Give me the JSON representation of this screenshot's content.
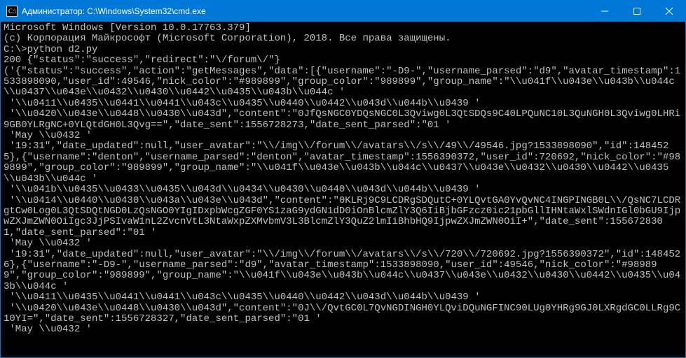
{
  "titlebar": {
    "icon_name": "cmd-icon",
    "title": "Администратор: C:\\Windows\\System32\\cmd.exe",
    "min_label": "minimize",
    "max_label": "maximize",
    "close_label": "close"
  },
  "terminal": {
    "lines": [
      "Microsoft Windows [Version 10.0.17763.379]",
      "(c) Корпорация Майкрософт (Microsoft Corporation), 2018. Все права защищены.",
      "",
      "C:\\>python d2.py",
      "200 {\"status\":\"success\",\"redirect\":\"\\/forum\\/\"}",
      "('{\"status\":\"success\",\"action\":\"getMessages\",\"data\":[{\"username\":\"-D9-\",\"username_parsed\":\"d9\",\"avatar_timestamp\":1533898090,\"user_id\":49546,\"nick_color\":\"#989899\",\"group_color\":\"989899\",\"group_name\":\"\\\\u041f\\\\u043e\\\\u043b\\\\u044c\\\\u0437\\\\u043e\\\\u0432\\\\u0430\\\\u0442\\\\u0435\\\\u043b\\\\u044c '",
      " '\\\\u0411\\\\u0435\\\\u0441\\\\u0441\\\\u043c\\\\u0435\\\\u0440\\\\u0442\\\\u043d\\\\u044b\\\\u0439 '",
      " '\\\\u0420\\\\u043e\\\\u0448\\\\u0430\\\\u043d\",\"content\":\"0JfQsNGC0YDQsNGC0L3Qviwg0L3QtSDQs9C40LPQuNC10L3QuNGH0L3Qviwg0LHRi9GB0YLRgNC+0YLQtdGH0L3Qvg==\",\"date_sent\":1556728273,\"date_sent_parsed\":\"01 '",
      " 'May \\\\u0432 '",
      " '19:31\",\"date_updated\":null,\"user_avatar\":\"\\\\/img\\\\/forum\\\\/avatars\\\\/s\\\\/49\\\\/49546.jpg?1533898090\",\"id\":1484525},{\"username\":\"denton\",\"username_parsed\":\"denton\",\"avatar_timestamp\":1556390372,\"user_id\":720692,\"nick_color\":\"#989899\",\"group_color\":\"989899\",\"group_name\":\"\\\\u041f\\\\u043e\\\\u043b\\\\u044c\\\\u0437\\\\u043e\\\\u0432\\\\u0430\\\\u0442\\\\u0435\\\\u043b\\\\u044c '",
      " '\\\\u041b\\\\u0435\\\\u0433\\\\u0435\\\\u043d\\\\u0434\\\\u0430\\\\u0440\\\\u043d\\\\u044b\\\\u0439 '",
      " '\\\\u0414\\\\u0440\\\\u0430\\\\u043a\\\\u043e\\\\u043d\",\"content\":\"0KLRj9C9LCDRgSDQutC+0YLQvtGA0YvQvNC4INGPINGB0L\\\\/QsNC7LCDRgtCw0Log0L3QtSDQtNGD0LzQsNGO0YIgIDxpbWcgZGF0YS1zaG9ydGN1dD0iOnBlcmZlY3Q6IiBjbGFzcz0ic21pbGllIHNtaWxlSWdnIGl0bGU9IjpwZXJmZWN0OiIgc3JjPSIvaW1nL2ZvcnVtL3NtaWxpZXMvbmV3L3BlcmZlY3QuZ2lmIiBhbHQ9IjpwZXJmZWN0OiI+\",\"date_sent\":1556728301,\"date_sent_parsed\":\"01 '",
      " 'May \\\\u0432 '",
      " '19:31\",\"date_updated\":null,\"user_avatar\":\"\\\\/img\\\\/forum\\\\/avatars\\\\/s\\\\/720\\\\/720692.jpg?1556390372\",\"id\":1484526},{\"username\":\"-D9-\",\"username_parsed\":\"d9\",\"avatar_timestamp\":1533898090,\"user_id\":49546,\"nick_color\":\"#989899\",\"group_color\":\"989899\",\"group_name\":\"\\\\u041f\\\\u043e\\\\u043b\\\\u044c\\\\u0437\\\\u043e\\\\u0432\\\\u0430\\\\u0442\\\\u0435\\\\u043b\\\\u044c '",
      " '\\\\u0411\\\\u0435\\\\u0441\\\\u0441\\\\u043c\\\\u0435\\\\u0440\\\\u0442\\\\u043d\\\\u044b\\\\u0439 '",
      " '\\\\u0420\\\\u043e\\\\u0448\\\\u0430\\\\u043d\",\"content\":\"0J\\\\/QvtGC0L7QvNGDINGH0YLQviDQuNGFINC90LUg0YHRg9GJ0LXRgdGC0LLRg9C10YI=\",\"date_sent\":1556728327,\"date_sent_parsed\":\"01 '",
      " 'May \\\\u0432 '"
    ]
  }
}
